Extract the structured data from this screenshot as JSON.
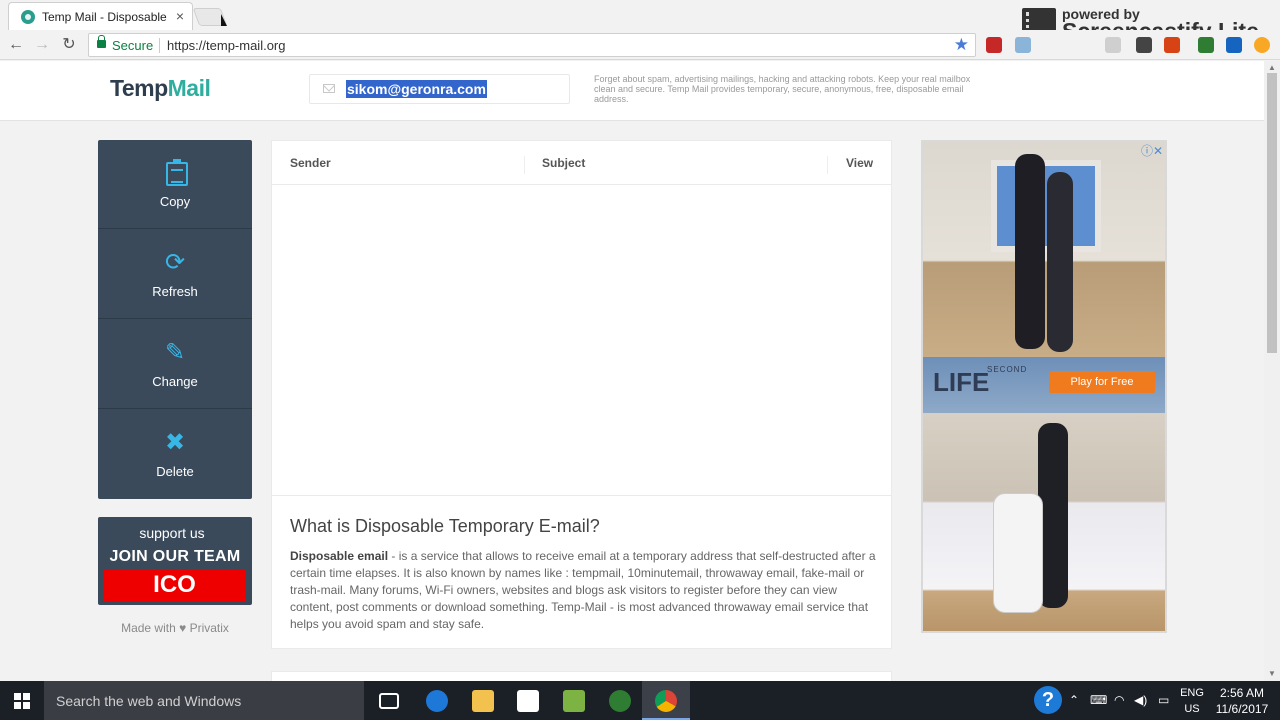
{
  "browser": {
    "tab_title": "Temp Mail - Disposable T",
    "tab_close": "×",
    "secure_label": "Secure",
    "url": "https://temp-mail.org",
    "watermark_small": "powered by",
    "watermark_big": "Screencastify Lite"
  },
  "header": {
    "logo_part1": "Temp",
    "logo_part2": "Mail",
    "email": "sikom@geronra.com",
    "blurb": "Forget about spam, advertising mailings, hacking and attacking robots. Keep your real mailbox clean and secure. Temp Mail provides temporary, secure, anonymous, free, disposable email address."
  },
  "sidebar": {
    "items": [
      {
        "label": "Copy",
        "icon": "clipboard-icon"
      },
      {
        "label": "Refresh",
        "icon": "refresh-icon",
        "glyph": "⟳"
      },
      {
        "label": "Change",
        "icon": "pen-icon",
        "glyph": "✎"
      },
      {
        "label": "Delete",
        "icon": "delete-icon",
        "glyph": "✖"
      }
    ]
  },
  "promo": {
    "line1": "support us",
    "line2": "JOIN OUR TEAM",
    "line3": "ICO"
  },
  "made_with": "Made with ♥ Privatix",
  "inbox": {
    "columns": [
      "Sender",
      "Subject",
      "View"
    ]
  },
  "info": {
    "title": "What is Disposable Temporary E-mail?",
    "bold": "Disposable email",
    "body": " - is a service that allows to receive email at a temporary address that self-destructed after a certain time elapses. It is also known by names like : tempmail, 10minutemail, throwaway email, fake-mail or trash-mail. Many forums, Wi-Fi owners, websites and blogs ask visitors to register before they can view content, post comments or download something. Temp-Mail - is most advanced throwaway email service that helps you avoid spam and stay safe."
  },
  "ad": {
    "brand_small": "SECOND",
    "brand": "LIFE",
    "cta": "Play for Free",
    "close": "ⓘ✕"
  },
  "taskbar": {
    "search_placeholder": "Search the web and Windows",
    "lang_line1": "ENG",
    "lang_line2": "US",
    "time": "2:56 AM",
    "date": "11/6/2017",
    "help": "?"
  },
  "colors": {
    "brand_dark": "#2f3e4e",
    "brand_teal": "#2fae9f",
    "sidebar_bg": "#3a4a5b",
    "icon_blue": "#38b6e6",
    "ico_red": "#ee0000"
  }
}
